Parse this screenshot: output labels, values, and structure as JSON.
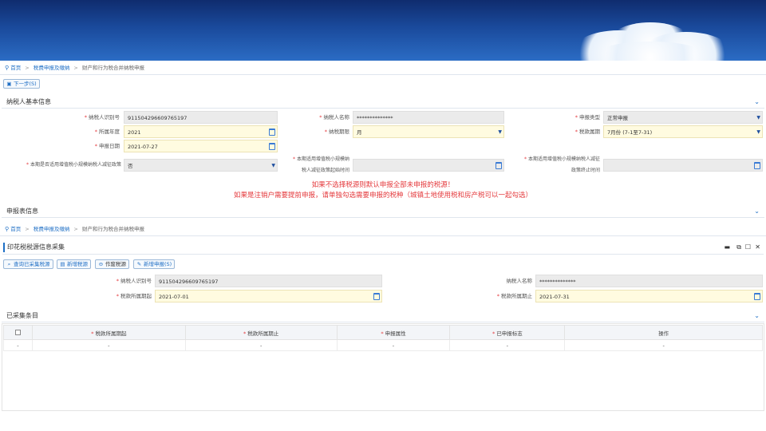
{
  "breadcrumb": {
    "home": "首页",
    "level1": "税费申报及缴纳",
    "current": "财产和行为税合并纳税申报",
    "sep": ">"
  },
  "toolbar": {
    "next_label": "下一步(S)"
  },
  "taxpayer_section": {
    "title": "纳税人基本信息",
    "fields": {
      "tin_label": "纳税人识别号",
      "tin_value": "911504296609765197",
      "name_label": "纳税人名称",
      "name_value": "**************",
      "decl_type_label": "申报类型",
      "decl_type_value": "正常申报",
      "year_label": "所属年度",
      "year_value": "2021",
      "period_label": "纳税期限",
      "period_value": "月",
      "belong_period_label": "税款属期",
      "belong_period_value": "7月份 (7-1至7-31)",
      "date_label": "申报日期",
      "date_value": "2021-07-27",
      "policy_label": "本期是否适用增值税小规模纳税人减征政策",
      "policy_value": "否",
      "policy_start_label_1": "本期适用增值税小规模纳",
      "policy_start_label_2": "税人减征政策起始时间",
      "policy_end_label_1": "本期适用增值税小规模纳税人减征",
      "policy_end_label_2": "政策终止时间"
    },
    "warning_line1": "如果不选择税源则默认申报全部未申报的税源！",
    "warning_line2": "如果是注销户需要提前申报，请单独勾选需要申报的税种（城镇土地使用税和房产税可以一起勾选）"
  },
  "declaration_section": {
    "title": "申报表信息"
  },
  "breadcrumb2": {
    "home": "首页",
    "level1": "税费申报及缴纳",
    "current": "财产和行为税合并纳税申报",
    "sep": ">"
  },
  "stamp_panel": {
    "title": "印花税税源信息采集",
    "buttons": {
      "query": "查询已采集税源",
      "add": "新增税源",
      "void": "作废税源",
      "new_decl": "新增申报(S)"
    },
    "tin_label": "纳税人识别号",
    "tin_value": "911504296609765197",
    "name_label": "纳税人名称",
    "name_value": "**************",
    "start_label": "税款所属期起",
    "start_value": "2021-07-01",
    "end_label": "税款所属期止",
    "end_value": "2021-07-31"
  },
  "collected": {
    "title": "已采集条目",
    "columns": [
      "税款所属期起",
      "税款所属期止",
      "申报属性",
      "已申报标志",
      "操作"
    ],
    "rows": [
      [
        "-",
        "-",
        "-",
        "-",
        "-",
        "-"
      ]
    ]
  }
}
